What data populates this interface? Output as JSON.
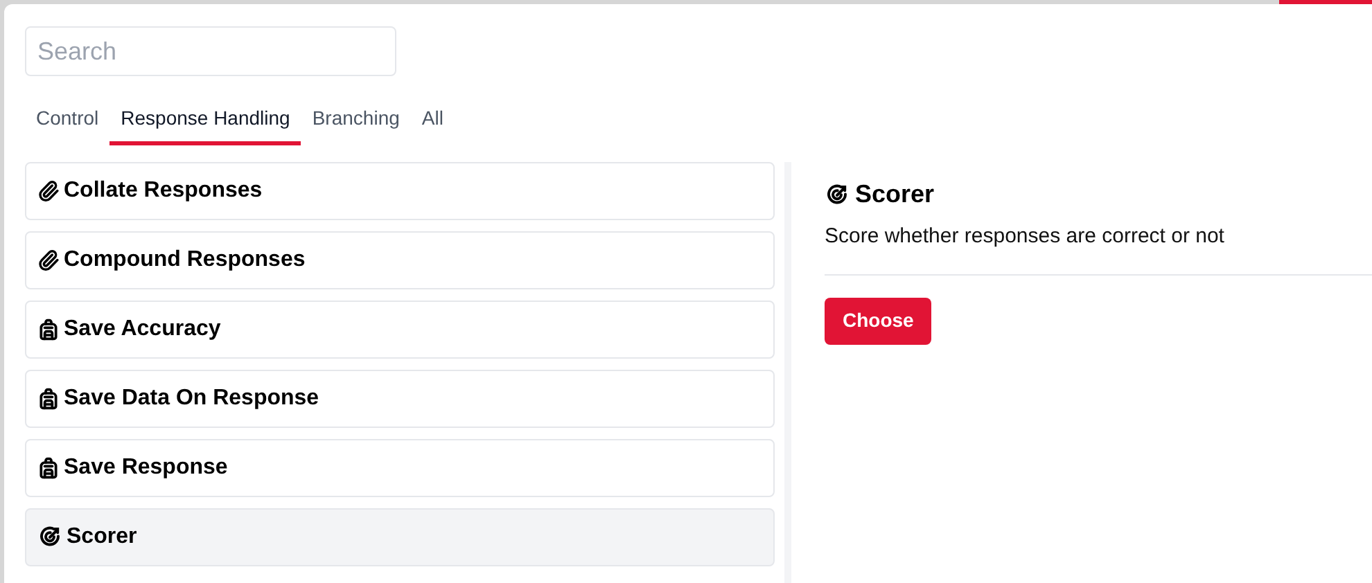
{
  "search": {
    "placeholder": "Search"
  },
  "tabs": [
    {
      "label": "Control",
      "selected": false
    },
    {
      "label": "Response Handling",
      "selected": true
    },
    {
      "label": "Branching",
      "selected": false
    },
    {
      "label": "All",
      "selected": false
    }
  ],
  "items": [
    {
      "label": "Collate Responses",
      "kind": "clip",
      "selected": false
    },
    {
      "label": "Compound Responses",
      "kind": "clip",
      "selected": false
    },
    {
      "label": "Save Accuracy",
      "kind": "save",
      "selected": false
    },
    {
      "label": "Save Data On Response",
      "kind": "save",
      "selected": false
    },
    {
      "label": "Save Response",
      "kind": "save",
      "selected": false
    },
    {
      "label": "Scorer",
      "kind": "score",
      "selected": true
    }
  ],
  "detail": {
    "title": "Scorer",
    "kind": "score",
    "description": "Score whether responses are correct or not",
    "button": "Choose"
  }
}
